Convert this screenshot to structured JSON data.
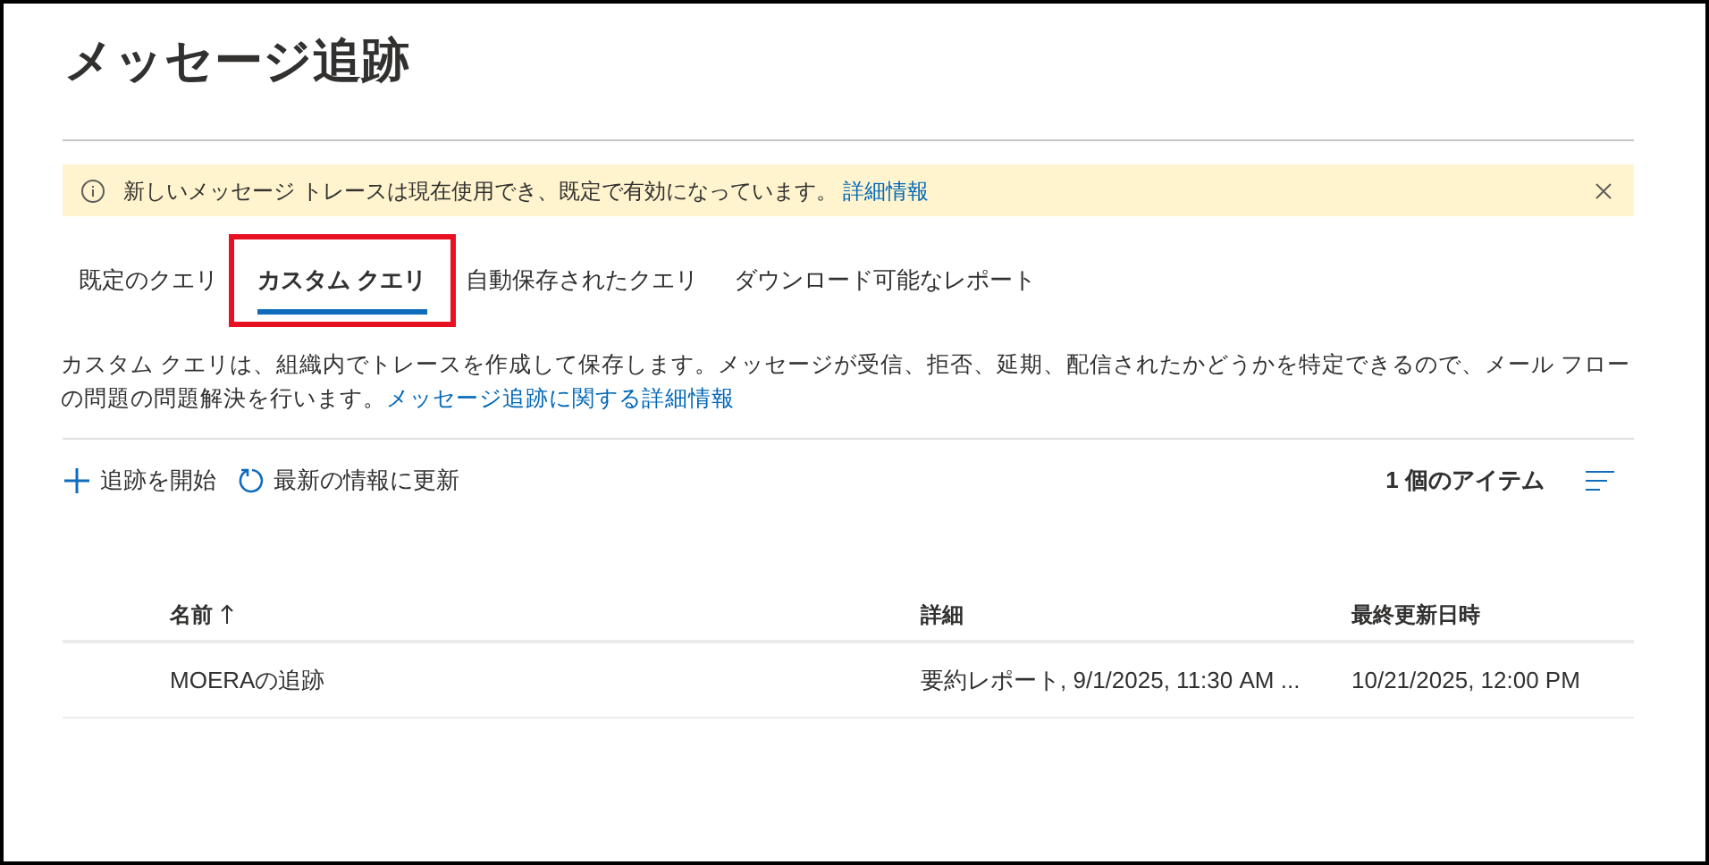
{
  "page": {
    "title": "メッセージ追跡"
  },
  "banner": {
    "text": "新しいメッセージ トレースは現在使用でき、既定で有効になっています。",
    "link": "詳細情報"
  },
  "tabs": [
    {
      "label": "既定のクエリ",
      "selected": false,
      "highlighted": false
    },
    {
      "label": "カスタム クエリ",
      "selected": true,
      "highlighted": true
    },
    {
      "label": "自動保存されたクエリ",
      "selected": false,
      "highlighted": false
    },
    {
      "label": "ダウンロード可能なレポート",
      "selected": false,
      "highlighted": false
    }
  ],
  "description": {
    "text": "カスタム クエリは、組織内でトレースを作成して保存します。メッセージが受信、拒否、延期、配信されたかどうかを特定できるので、メール フローの問題の問題解決を行います。",
    "link": "メッセージ追跡に関する詳細情報"
  },
  "toolbar": {
    "start": "追跡を開始",
    "refresh": "最新の情報に更新",
    "count": "1 個のアイテム"
  },
  "table": {
    "columns": [
      {
        "label": "名前",
        "sorted": true
      },
      {
        "label": "詳細",
        "sorted": false
      },
      {
        "label": "最終更新日時",
        "sorted": false
      }
    ],
    "rows": [
      [
        "MOERAの追跡",
        "要約レポート, 9/1/2025, 11:30 AM ...",
        "10/21/2025, 12:00 PM"
      ]
    ]
  }
}
